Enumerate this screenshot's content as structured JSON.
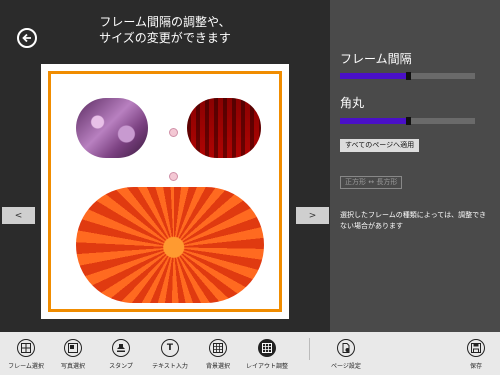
{
  "header": {
    "title_line1": "フレーム間隔の調整や、",
    "title_line2": "サイズの変更ができます"
  },
  "nav": {
    "prev": "<",
    "next": ">"
  },
  "settings": {
    "frame_gap_label": "フレーム間隔",
    "frame_gap_value": 0.5,
    "corner_radius_label": "角丸",
    "corner_radius_value": 0.5,
    "apply_all_label": "すべてのページへ適用",
    "aspect_toggle_label": "正方形 ↔ 長方形",
    "note": "選択したフレームの種類によっては、調整できない場合があります"
  },
  "toolbar": {
    "items": [
      {
        "label": "フレーム選択",
        "icon": "frame-grid-icon"
      },
      {
        "label": "写真選択",
        "icon": "photo-select-icon"
      },
      {
        "label": "スタンプ",
        "icon": "stamp-icon"
      },
      {
        "label": "テキスト入力",
        "icon": "text-icon"
      },
      {
        "label": "背景選択",
        "icon": "background-icon"
      },
      {
        "label": "レイアウト調整",
        "icon": "layout-icon"
      },
      {
        "label": "ページ設定",
        "icon": "page-settings-icon"
      },
      {
        "label": "保存",
        "icon": "save-icon"
      }
    ]
  },
  "colors": {
    "accent_slider": "#4a10c8",
    "frame_border": "#f08c00"
  }
}
